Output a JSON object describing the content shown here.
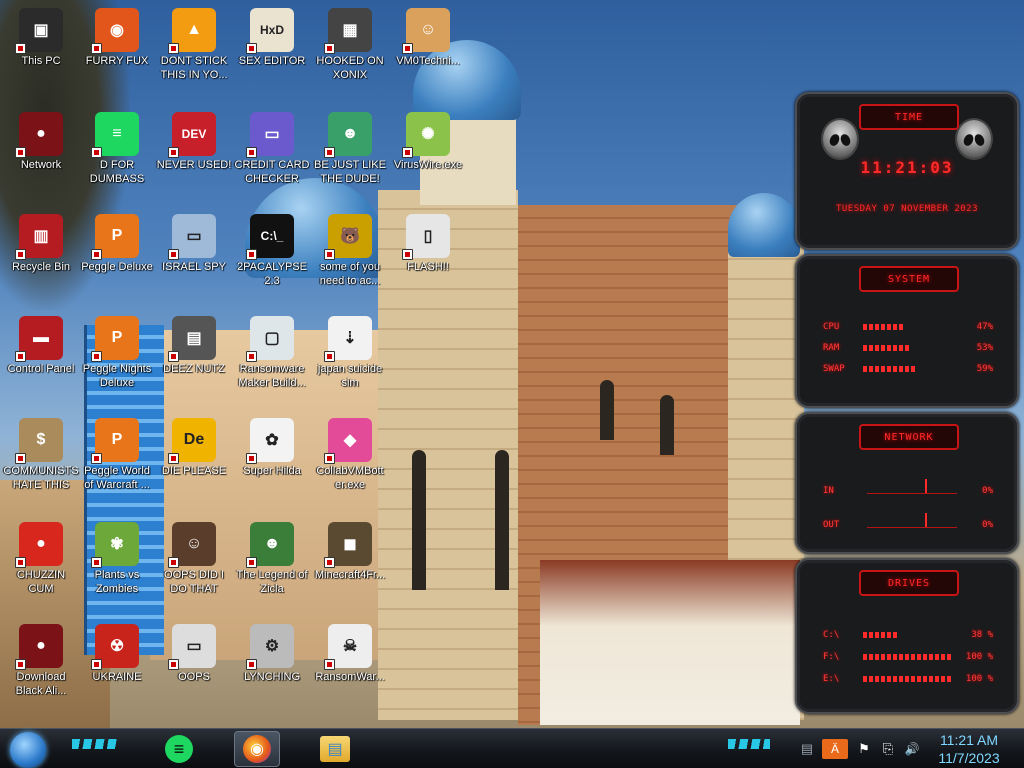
{
  "desktop": {
    "icons": [
      {
        "label": "This PC",
        "glyph": "▣",
        "color": "#2b2b2b",
        "icon": "computer-icon"
      },
      {
        "label": "FURRY FUX",
        "glyph": "◉",
        "color": "#e3561b",
        "icon": "firefox-icon"
      },
      {
        "label": "DONT STICK THIS IN YO...",
        "glyph": "▲",
        "color": "#f39c12",
        "icon": "vlc-cone-icon"
      },
      {
        "label": "SEX EDITOR",
        "glyph": "HxD",
        "color": "#e9e3d0",
        "icon": "hex-editor-icon"
      },
      {
        "label": "HOOKED ON XONIX",
        "glyph": "▦",
        "color": "#444444",
        "icon": "xonix-game-icon"
      },
      {
        "label": "VM0Techni...",
        "glyph": "☺",
        "color": "#d9a15c",
        "icon": "doctor-icon"
      },
      {
        "label": "Network",
        "glyph": "●",
        "color": "#7a1218",
        "icon": "network-icon"
      },
      {
        "label": "D FOR DUMBASS",
        "glyph": "≡",
        "color": "#1ed760",
        "icon": "spotify-icon"
      },
      {
        "label": "NEVER USED!",
        "glyph": "DEV",
        "color": "#c8202a",
        "icon": "dev-cpp-icon"
      },
      {
        "label": "CREDIT CARD CHECKER",
        "glyph": "▭",
        "color": "#6a5acd",
        "icon": "credit-card-icon"
      },
      {
        "label": "BE JUST LIKE THE DUDE!",
        "glyph": "☻",
        "color": "#3aa06a",
        "icon": "santa-icon"
      },
      {
        "label": "VirusWire.exe",
        "glyph": "✺",
        "color": "#8bc34a",
        "icon": "lime-icon"
      },
      {
        "label": "Recycle Bin",
        "glyph": "▥",
        "color": "#b51c22",
        "icon": "recycle-bin-icon"
      },
      {
        "label": "Peggle Deluxe",
        "glyph": "P",
        "color": "#e8751a",
        "icon": "peggle-icon"
      },
      {
        "label": "ISRAEL SPY",
        "glyph": "▭",
        "color": "#9fb9d8",
        "icon": "monitor-icon"
      },
      {
        "label": "2PACALYPSE 2.3",
        "glyph": "C:\\_",
        "color": "#111111",
        "icon": "terminal-icon"
      },
      {
        "label": "some of you need to ac...",
        "glyph": "🐻",
        "color": "#c9a000",
        "icon": "beaver-icon"
      },
      {
        "label": "FLASH!!",
        "glyph": "▯",
        "color": "#e6e6e6",
        "icon": "flash-icon"
      },
      {
        "label": "Control Panel",
        "glyph": "▬",
        "color": "#b51c22",
        "icon": "control-panel-icon"
      },
      {
        "label": "Peggle Nights Deluxe",
        "glyph": "P",
        "color": "#e8751a",
        "icon": "peggle-nights-icon"
      },
      {
        "label": "DEEZ NUTZ",
        "glyph": "▤",
        "color": "#555555",
        "icon": "windows-stack-icon"
      },
      {
        "label": "Ransomware Maker Build...",
        "glyph": "▢",
        "color": "#dfe6ea",
        "icon": "ransomware-builder-icon"
      },
      {
        "label": "japan suicide sim",
        "glyph": "⇣",
        "color": "#f2f2f2",
        "icon": "japan-sim-icon"
      },
      {
        "label": "COMMUNISTS HATE THIS G...",
        "glyph": "$",
        "color": "#a98b5c",
        "icon": "money-bag-icon"
      },
      {
        "label": "Peggle World of Warcraft ...",
        "glyph": "P",
        "color": "#e8751a",
        "icon": "peggle-wow-icon"
      },
      {
        "label": "DIE PLEASE",
        "glyph": "De",
        "color": "#f0b400",
        "icon": "de-icon"
      },
      {
        "label": "Super Hilda",
        "glyph": "✿",
        "color": "#f3f3f3",
        "icon": "pixel-character-icon"
      },
      {
        "label": "CollabVMBott er.exe",
        "glyph": "◆",
        "color": "#e34a98",
        "icon": "collabvm-icon"
      },
      {
        "label": "CHUZZIN CUM",
        "glyph": "●",
        "color": "#d8281e",
        "icon": "chuzzle-icon"
      },
      {
        "label": "Plants vs Zombies",
        "glyph": "✾",
        "color": "#6da83a",
        "icon": "pvz-icon"
      },
      {
        "label": "OOPS DID I DO THAT",
        "glyph": "☺",
        "color": "#5a3e2b",
        "icon": "portrait-icon"
      },
      {
        "label": "The Legend of Zicla",
        "glyph": "☻",
        "color": "#3a7e3a",
        "icon": "zelda-icon"
      },
      {
        "label": "Minecraft4Fr...",
        "glyph": "◼",
        "color": "#5b4a32",
        "icon": "minecraft-icon"
      },
      {
        "label": "Download Black Ali...",
        "glyph": "●",
        "color": "#7a1218",
        "icon": "alienware-icon"
      },
      {
        "label": "UKRAINE",
        "glyph": "☢",
        "color": "#c9241c",
        "icon": "radiation-icon"
      },
      {
        "label": "OOPS",
        "glyph": "▭",
        "color": "#dddddd",
        "icon": "window-icon"
      },
      {
        "label": "LYNCHING",
        "glyph": "⚙",
        "color": "#bbbbbb",
        "icon": "gear-flag-icon"
      },
      {
        "label": "RansomWar...",
        "glyph": "☠",
        "color": "#eeeeee",
        "icon": "skull-icon"
      }
    ]
  },
  "widgets": {
    "time": {
      "title": "TIME",
      "clock": "11:21:03",
      "date": "TUESDAY 07 NOVEMBER 2023"
    },
    "system": {
      "title": "SYSTEM",
      "rows": [
        {
          "label": "CPU",
          "value": "47%",
          "level": 0.47
        },
        {
          "label": "RAM",
          "value": "53%",
          "level": 0.53
        },
        {
          "label": "SWAP",
          "value": "59%",
          "level": 0.59
        }
      ]
    },
    "network": {
      "title": "NETWORK",
      "rows": [
        {
          "label": "IN",
          "value": "0%"
        },
        {
          "label": "OUT",
          "value": "0%"
        }
      ]
    },
    "drives": {
      "title": "DRIVES",
      "rows": [
        {
          "label": "C:\\",
          "value": "38 %",
          "level": 0.38
        },
        {
          "label": "F:\\",
          "value": "100 %",
          "level": 1.0
        },
        {
          "label": "E:\\",
          "value": "100 %",
          "level": 1.0
        }
      ]
    }
  },
  "taskbar": {
    "time": "11:21 AM",
    "date": "11/7/2023",
    "apps": [
      {
        "name": "spotify-taskbar-icon",
        "glyph": "≡",
        "color": "#1ed760"
      },
      {
        "name": "firefox-taskbar-icon",
        "glyph": "◉",
        "color": "#e3561b"
      },
      {
        "name": "file-explorer-taskbar-icon",
        "glyph": "▤",
        "color": "#f3c54a"
      }
    ],
    "tray_glyphs": {
      "ie": "Ä",
      "flag": "⚑",
      "network": "⎘",
      "volume": "🔊",
      "notifications": "▤"
    }
  }
}
